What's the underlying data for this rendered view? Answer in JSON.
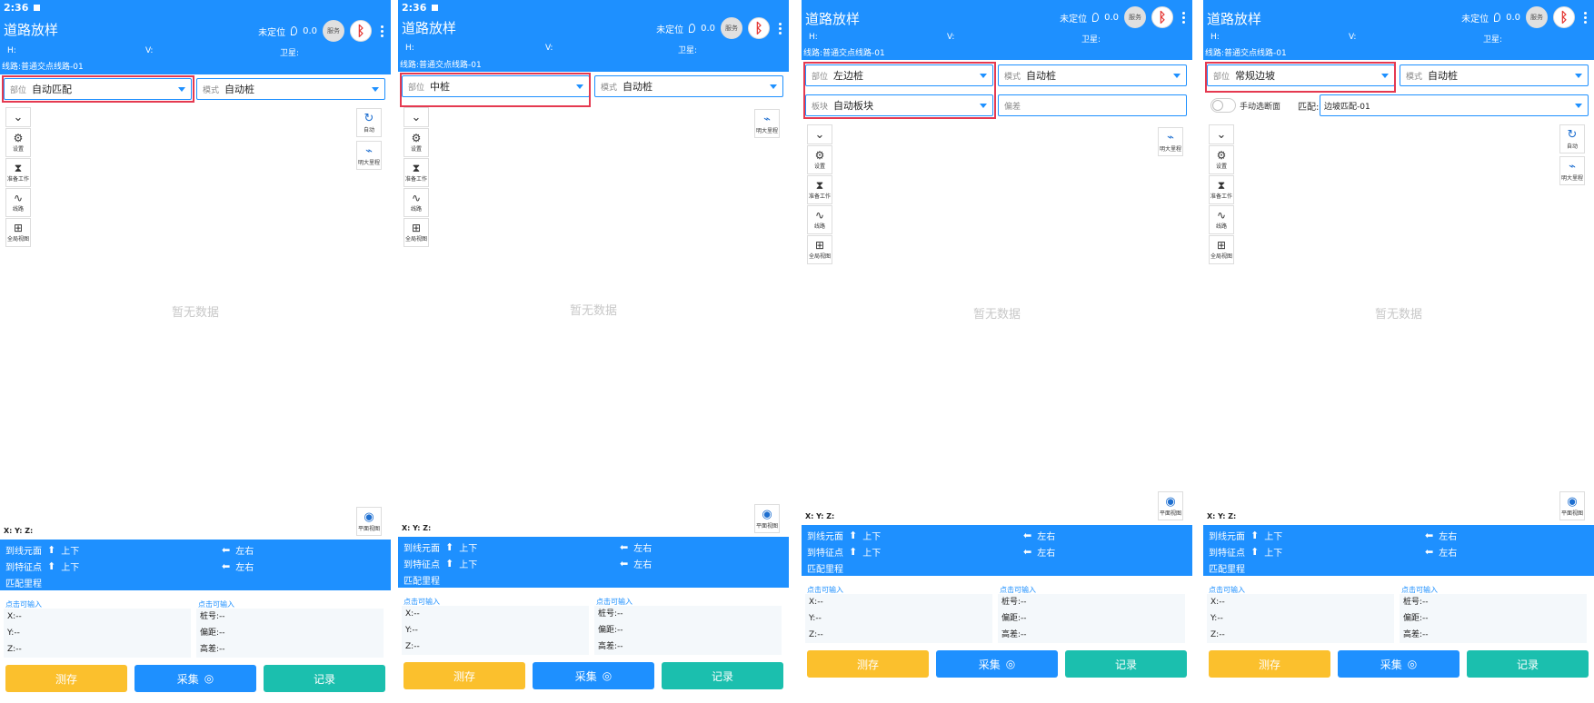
{
  "status_time": "2:36",
  "app_title": "道路放样",
  "locate_status": "未定位",
  "signal_value": "0.0",
  "gnss_label": "服务",
  "h_label": "H:",
  "v_label": "V:",
  "sat_label": "卫星:",
  "line_name": "线路:普通交点线路-01",
  "part_label": "部位",
  "mode_label": "模式",
  "mode_value": "自动桩",
  "block_label": "板块",
  "block_value": "自动板块",
  "offset_placeholder": "偏差",
  "manual_section_label": "手动选断面",
  "match_label": "匹配:",
  "match_value": "边坡匹配-01",
  "tools": {
    "settings": "设置",
    "prep": "准备工作",
    "route": "线路",
    "fullview": "全局视图"
  },
  "right_tools": {
    "auto": "自动",
    "mileage": "明大里程"
  },
  "nodata": "暂无数据",
  "plan_view": "平面视图",
  "xyz": "X:  Y:  Z:",
  "panel": {
    "to_element": "到线元面",
    "to_feature": "到特征点",
    "updown": "上下",
    "leftright": "左右",
    "match_mileage": "匹配里程"
  },
  "inputs": {
    "hint": "点击可输入",
    "x": "X:--",
    "y": "Y:--",
    "z": "Z:--",
    "station": "桩号:--",
    "offset": "偏距:--",
    "height_diff": "高差:--"
  },
  "buttons": {
    "measure_save": "测存",
    "collect": "采集",
    "record": "记录"
  },
  "screens": [
    {
      "part_value": "自动匹配"
    },
    {
      "part_value": "中桩"
    },
    {
      "part_value": "左边桩"
    },
    {
      "part_value": "常规边坡"
    }
  ],
  "colors": {
    "primary": "#1e90ff",
    "yellow": "#fbc02d",
    "teal": "#1bbfae",
    "highlight": "#e53950"
  }
}
